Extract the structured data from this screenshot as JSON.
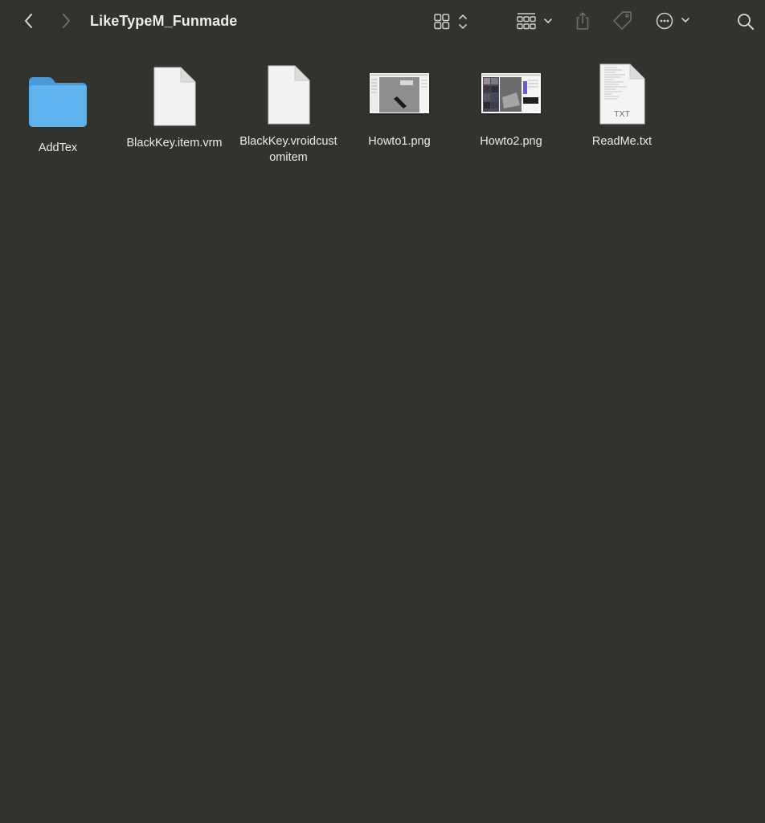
{
  "window": {
    "title": "LikeTypeM_Funmade"
  },
  "toolbar": {
    "back_icon": "chevron-left-icon",
    "forward_icon": "chevron-right-icon",
    "view_icon": "icon-view-grid-icon",
    "group_icon": "group-by-icon",
    "share_icon": "share-icon",
    "tag_icon": "tag-icon",
    "more_icon": "ellipsis-circle-icon",
    "search_icon": "search-icon"
  },
  "files": [
    {
      "name": "AddTex",
      "kind": "folder"
    },
    {
      "name": "BlackKey.item.vrm",
      "kind": "document"
    },
    {
      "name": "BlackKey.vroidcustomitem",
      "kind": "document"
    },
    {
      "name": "Howto1.png",
      "kind": "image"
    },
    {
      "name": "Howto2.png",
      "kind": "image"
    },
    {
      "name": "ReadMe.txt",
      "kind": "text",
      "badge": "TXT"
    }
  ],
  "colors": {
    "background": "#32322f",
    "folder": "#5fb3ee",
    "text": "#eaeaea"
  }
}
